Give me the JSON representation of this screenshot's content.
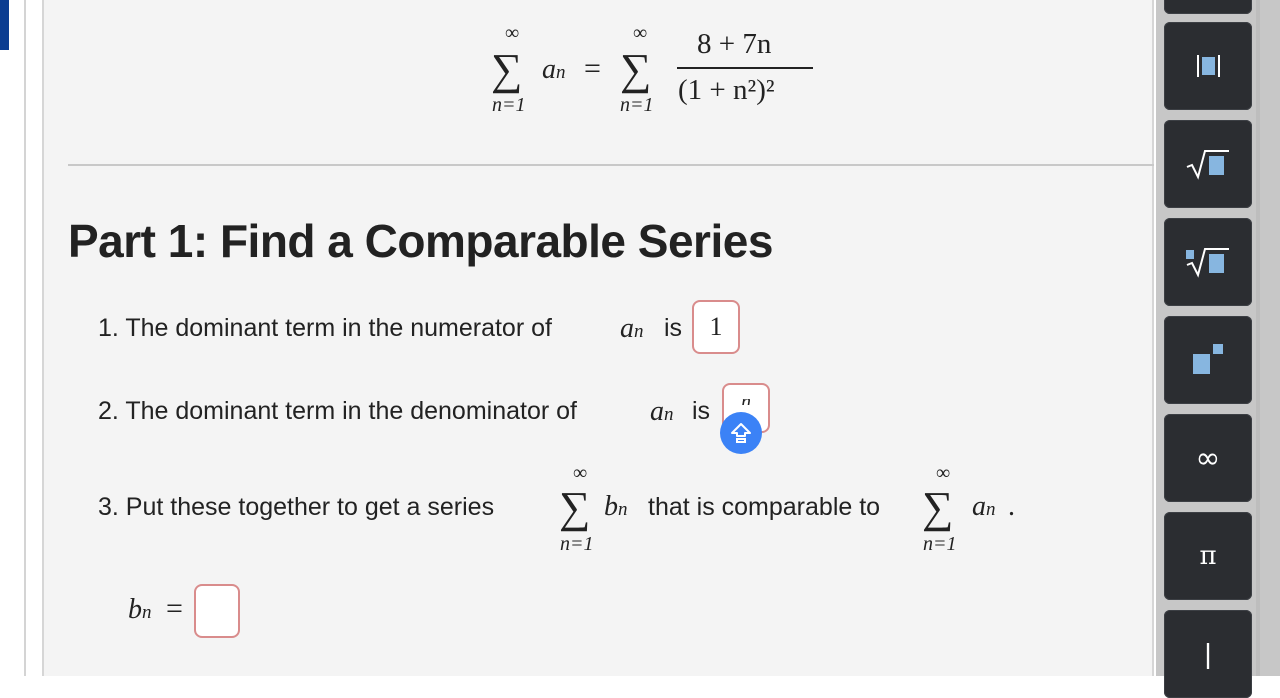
{
  "series": {
    "infinity": "∞",
    "lower_index": "n=1",
    "a_n": "an",
    "equals": "=",
    "numerator": "8 + 7n",
    "denominator": "(1 + n²)²"
  },
  "part1": {
    "heading": "Part 1: Find a Comparable Series",
    "q1": {
      "text": "1. The dominant term in the numerator of",
      "var": "a",
      "sub": "n",
      "is": "is",
      "answer": "1"
    },
    "q2": {
      "text": "2. The dominant term in the denominator of",
      "var": "a",
      "sub": "n",
      "is": "is",
      "answer": "n"
    },
    "q3": {
      "text_before": "3. Put these together to get a series",
      "b_var": "b",
      "b_sub": "n",
      "text_middle": "that is comparable to",
      "a_var": "a",
      "a_sub": "n",
      "period": "."
    },
    "bn_label": {
      "var": "b",
      "sub": "n",
      "equals": "="
    }
  },
  "toolbar": {
    "buttons": [
      {
        "icon": "fraction-icon"
      },
      {
        "icon": "superscript-icon"
      },
      {
        "icon": "sqrt-icon"
      },
      {
        "icon": "nth-root-icon"
      },
      {
        "icon": "power-icon"
      },
      {
        "icon": "infinity-icon",
        "label": "∞"
      },
      {
        "icon": "pi-icon",
        "label": "π"
      },
      {
        "icon": "abs-icon",
        "label": "|"
      }
    ]
  },
  "colors": {
    "accent": "#3b82f6",
    "toolbar_bg": "#2b2d31",
    "box_border": "#d98c8c",
    "icon_fill": "#87b6e0"
  }
}
